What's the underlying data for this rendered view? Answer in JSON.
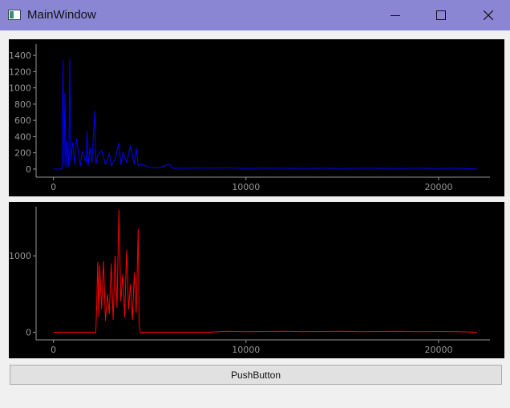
{
  "window": {
    "title": "MainWindow"
  },
  "icons": {
    "app": "app-window-icon",
    "minimize": "minimize-icon",
    "maximize": "maximize-icon",
    "close": "close-icon"
  },
  "button": {
    "label": "PushButton"
  },
  "chart_data": [
    {
      "type": "line",
      "color": "#0000ff",
      "xlim": [
        -900,
        22500
      ],
      "ylim": [
        -100,
        1500
      ],
      "xticks": [
        "0",
        "10000",
        "20000"
      ],
      "yticks": [
        "0",
        "200",
        "400",
        "600",
        "800",
        "1000",
        "1200",
        "1400"
      ],
      "series": [
        {
          "x": [
            0,
            450,
            500,
            550,
            600,
            650,
            700,
            800,
            850,
            900,
            1000,
            1100,
            1200,
            1400,
            1500,
            1700,
            1750,
            1800,
            1900,
            2000,
            2150,
            2200,
            2300,
            2500,
            2700,
            2900,
            3000,
            3200,
            3400,
            3500,
            3600,
            3800,
            4000,
            4200,
            4300,
            4400,
            4600,
            4800,
            5000,
            5500,
            6000,
            6200,
            7000,
            8000,
            9000,
            10000,
            11000,
            12000,
            13000,
            14000,
            15000,
            16000,
            17000,
            18000,
            19000,
            20000,
            21000,
            22000
          ],
          "y": [
            0,
            0,
            1340,
            50,
            940,
            20,
            350,
            30,
            1360,
            100,
            330,
            60,
            380,
            40,
            220,
            80,
            470,
            40,
            260,
            80,
            720,
            60,
            170,
            230,
            60,
            190,
            40,
            120,
            320,
            50,
            200,
            80,
            290,
            60,
            260,
            40,
            60,
            40,
            20,
            15,
            60,
            10,
            10,
            12,
            15,
            8,
            12,
            10,
            8,
            10,
            8,
            10,
            9,
            8,
            10,
            8,
            10,
            0
          ]
        }
      ]
    },
    {
      "type": "line",
      "color": "#ff0000",
      "xlim": [
        -900,
        22500
      ],
      "ylim": [
        -100,
        1600
      ],
      "xticks": [
        "0",
        "10000",
        "20000"
      ],
      "yticks": [
        "0",
        "1000"
      ],
      "series": [
        {
          "x": [
            0,
            2200,
            2250,
            2300,
            2350,
            2400,
            2500,
            2600,
            2700,
            2800,
            2900,
            3000,
            3100,
            3200,
            3300,
            3400,
            3500,
            3600,
            3700,
            3800,
            3900,
            4000,
            4100,
            4200,
            4300,
            4400,
            4450,
            4500,
            5000,
            8000,
            9000,
            10000,
            11000,
            12000,
            13000,
            14000,
            15000,
            16000,
            17000,
            18000,
            19000,
            20000,
            21000,
            22000
          ],
          "y": [
            0,
            0,
            400,
            920,
            200,
            880,
            300,
            930,
            150,
            500,
            240,
            900,
            160,
            1000,
            320,
            1600,
            400,
            760,
            200,
            1080,
            300,
            630,
            160,
            780,
            250,
            1350,
            100,
            0,
            0,
            0,
            12,
            8,
            10,
            12,
            8,
            10,
            12,
            8,
            10,
            12,
            8,
            10,
            8,
            0
          ]
        }
      ]
    }
  ]
}
